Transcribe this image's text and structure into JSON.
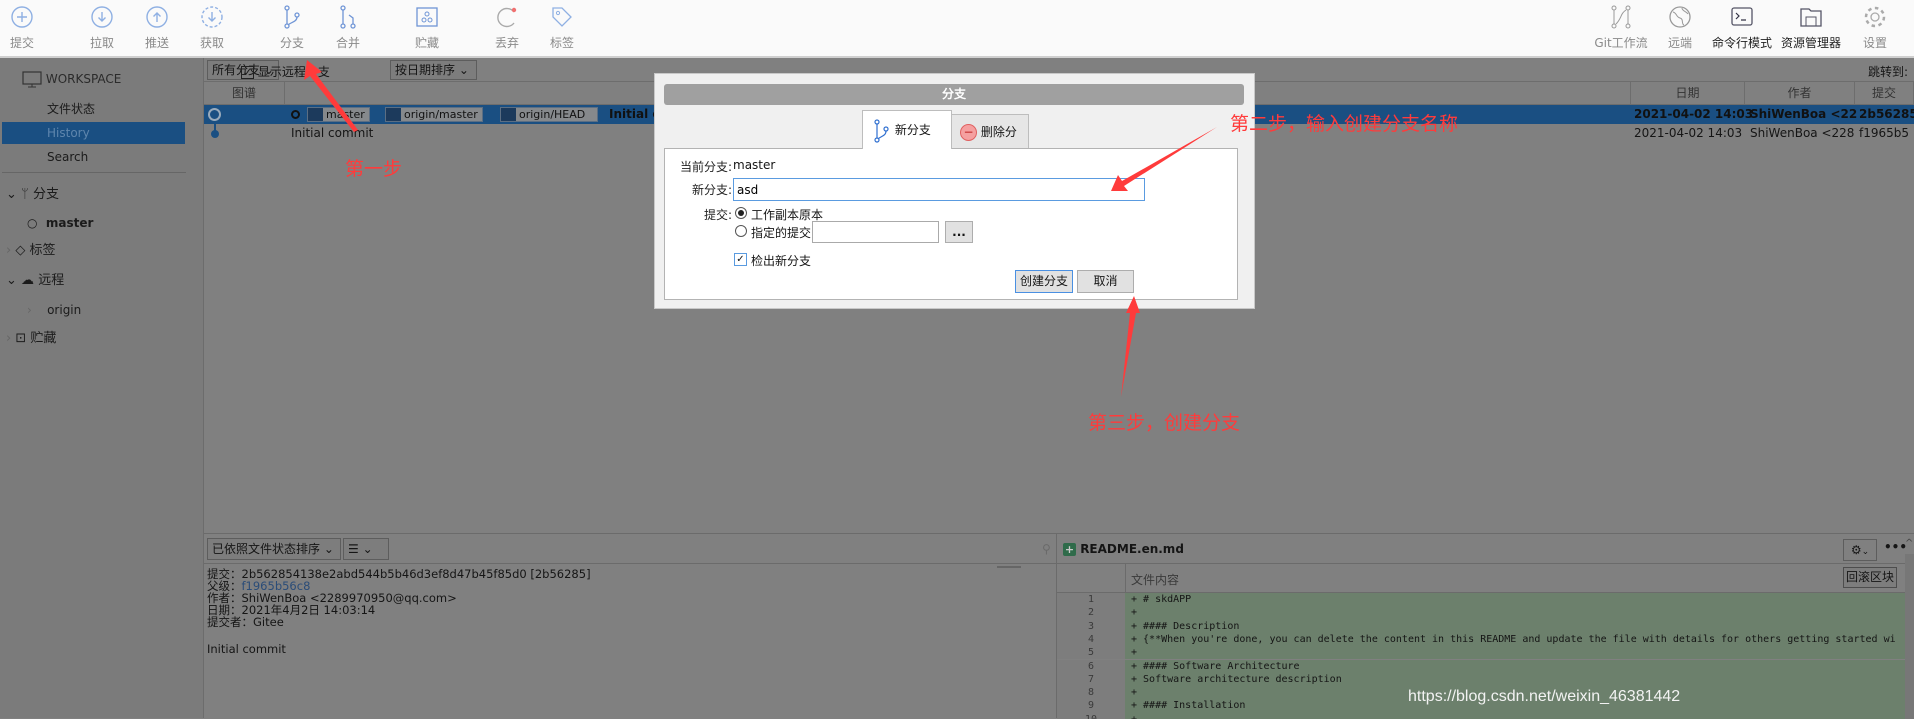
{
  "toolbar": {
    "left": [
      {
        "label": "提交",
        "icon": "plus-circle-icon"
      },
      {
        "label": "拉取",
        "icon": "arrow-down-circle-icon"
      },
      {
        "label": "推送",
        "icon": "arrow-up-circle-icon"
      },
      {
        "label": "获取",
        "icon": "fetch-icon"
      },
      {
        "label": "分支",
        "icon": "branch-icon"
      },
      {
        "label": "合并",
        "icon": "merge-icon"
      },
      {
        "label": "贮藏",
        "icon": "stash-icon"
      },
      {
        "label": "丢弃",
        "icon": "discard-icon"
      },
      {
        "label": "标签",
        "icon": "tag-icon"
      }
    ],
    "right": [
      {
        "label": "Git工作流",
        "icon": "git-flow-icon"
      },
      {
        "label": "远端",
        "icon": "globe-icon"
      },
      {
        "label": "命令行模式",
        "icon": "terminal-icon"
      },
      {
        "label": "资源管理器",
        "icon": "folder-icon"
      },
      {
        "label": "设置",
        "icon": "gear-icon"
      }
    ]
  },
  "sidebar": {
    "workspace": "WORKSPACE",
    "items": [
      "文件状态",
      "History",
      "Search"
    ],
    "selected": "History",
    "branches": {
      "label": "分支",
      "items": [
        "master"
      ]
    },
    "tags": {
      "label": "标签"
    },
    "remotes": {
      "label": "远程",
      "items": [
        "origin"
      ]
    },
    "stashes": {
      "label": "贮藏"
    }
  },
  "history": {
    "branch_filter": "所有分支",
    "show_remote_label": "显示远程分支",
    "show_remote_checked": true,
    "sort": "按日期排序",
    "jump_to": "跳转到:",
    "columns": [
      "图谱",
      "日期",
      "作者",
      "提交"
    ],
    "rows": [
      {
        "tags": [
          "master",
          "origin/master",
          "origin/HEAD"
        ],
        "message": "Initial commit",
        "date": "2021-04-02 14:03",
        "author": "ShiWenBoa <22",
        "commit": "2b56285",
        "selected": true
      },
      {
        "tags": [],
        "message": "Initial commit",
        "date": "2021-04-02 14:03",
        "author": "ShiWenBoa <228",
        "commit": "f1965b5",
        "selected": false
      }
    ]
  },
  "details": {
    "sort_select": "已依照文件状态排序",
    "view_icon": "list-icon",
    "lines": [
      {
        "label": "提交：",
        "value": "2b562854138e2abd544b5b46d3ef8d47b45f85d0 [2b56285]"
      },
      {
        "label": "父级：",
        "value": "f1965b56c8",
        "link": true
      },
      {
        "label": "作者：",
        "value": "ShiWenBoa <2289970950@qq.com>"
      },
      {
        "label": "日期：",
        "value": "2021年4月2日 14:03:14"
      },
      {
        "label": "提交者：",
        "value": "Gitee"
      }
    ],
    "message": "Initial commit"
  },
  "diff": {
    "file": "README.en.md",
    "column": "文件内容",
    "revert_hunk": "回滚区块",
    "lines": [
      "+ # skdAPP",
      "+",
      "+ #### Description",
      "+ {**When you're done, you can delete the content in this README and update the file with details for others getting started wi",
      "+",
      "+ #### Software Architecture",
      "+ Software architecture description",
      "+",
      "+ #### Installation",
      "+"
    ]
  },
  "dialog": {
    "title": "分支",
    "tabs": [
      {
        "label": "新分支",
        "active": true
      },
      {
        "label": "删除分支",
        "active": false
      }
    ],
    "current_branch_label": "当前分支:",
    "current_branch": "master",
    "new_branch_label": "新分支:",
    "new_branch_value": "asd",
    "commit_label": "提交:",
    "option_working_copy": "工作副本原本",
    "option_specified": "指定的提交:",
    "selected_option": "工作副本原本",
    "browse": "...",
    "checkout_label": "检出新分支",
    "checkout_checked": true,
    "create": "创建分支",
    "cancel": "取消"
  },
  "annotations": {
    "step1": "第一步",
    "step2": "第二步，输入创建分支名称",
    "step3": "第三步，创建分支",
    "color": "#ff3b3b"
  },
  "watermark": "https://blog.csdn.net/weixin_46381442"
}
